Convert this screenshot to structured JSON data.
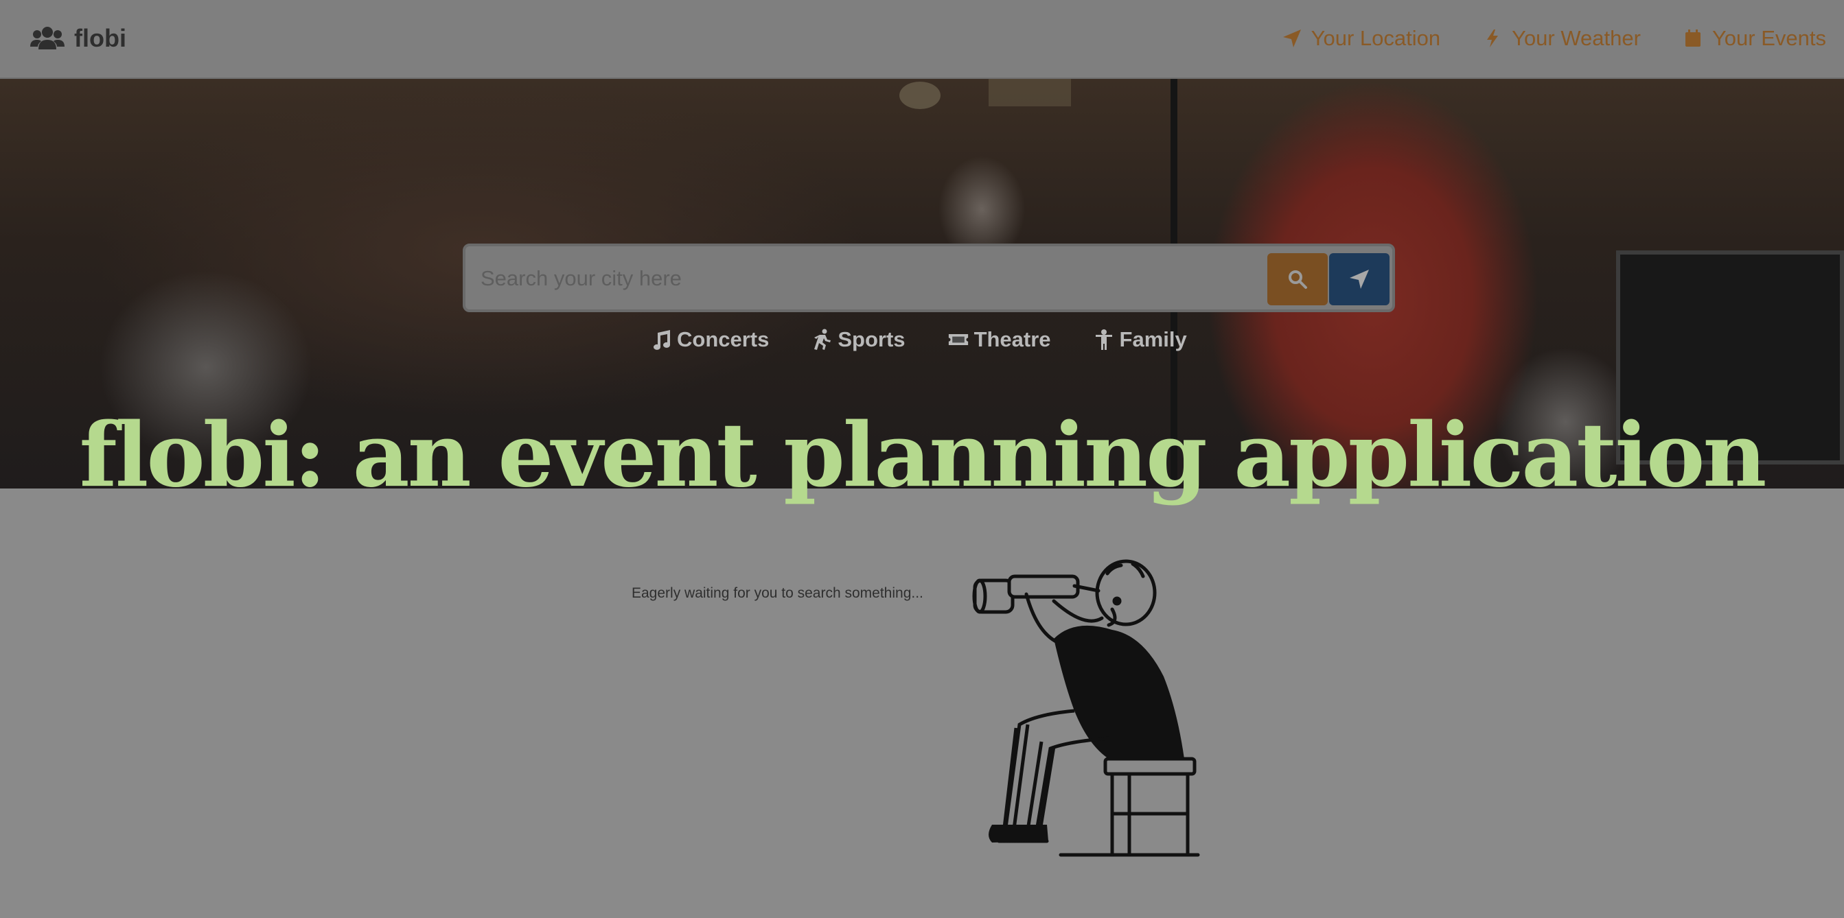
{
  "navbar": {
    "brand": "flobi",
    "brand_icon": "users-icon",
    "links": [
      {
        "label": "Your Location",
        "icon": "location-arrow-icon"
      },
      {
        "label": "Your Weather",
        "icon": "bolt-icon"
      },
      {
        "label": "Your Events",
        "icon": "calendar-icon"
      }
    ]
  },
  "search": {
    "placeholder": "Search your city here",
    "value": "",
    "search_button_icon": "search-icon",
    "locate_button_icon": "location-arrow-icon"
  },
  "categories": [
    {
      "label": "Concerts",
      "icon": "music-icon"
    },
    {
      "label": "Sports",
      "icon": "running-icon"
    },
    {
      "label": "Theatre",
      "icon": "ticket-icon"
    },
    {
      "label": "Family",
      "icon": "child-icon"
    }
  ],
  "headline": "flobi: an event planning application",
  "empty_state": {
    "message": "Eagerly waiting for you to search something..."
  },
  "colors": {
    "accent_orange": "#8a5a26",
    "headline_green": "#b5d98e",
    "locate_blue": "#1d3a5a"
  }
}
